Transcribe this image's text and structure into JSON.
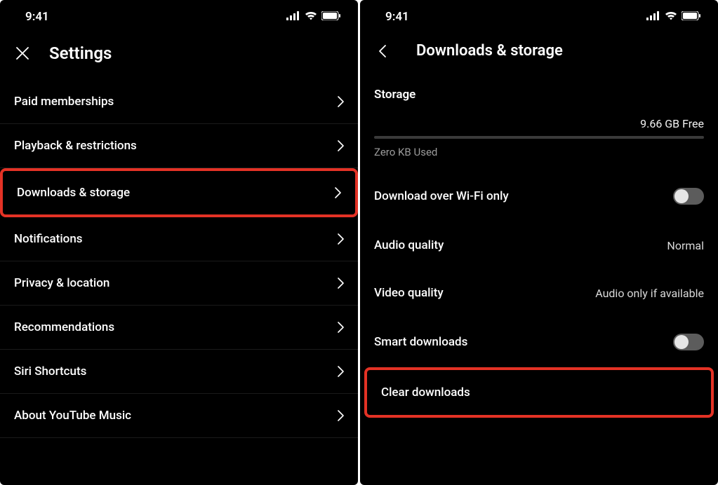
{
  "status": {
    "time": "9:41"
  },
  "left": {
    "title": "Settings",
    "items": [
      {
        "label": "Paid memberships"
      },
      {
        "label": "Playback & restrictions"
      },
      {
        "label": "Downloads & storage"
      },
      {
        "label": "Notifications"
      },
      {
        "label": "Privacy & location"
      },
      {
        "label": "Recommendations"
      },
      {
        "label": "Siri Shortcuts"
      },
      {
        "label": "About YouTube Music"
      }
    ]
  },
  "right": {
    "title": "Downloads & storage",
    "storage": {
      "title": "Storage",
      "free": "9.66 GB Free",
      "used": "Zero KB Used"
    },
    "wifi": {
      "label": "Download over Wi-Fi only",
      "on": false
    },
    "audio": {
      "label": "Audio quality",
      "value": "Normal"
    },
    "video": {
      "label": "Video quality",
      "value": "Audio only if available"
    },
    "smart": {
      "label": "Smart downloads",
      "on": false
    },
    "clear": {
      "label": "Clear downloads"
    }
  }
}
